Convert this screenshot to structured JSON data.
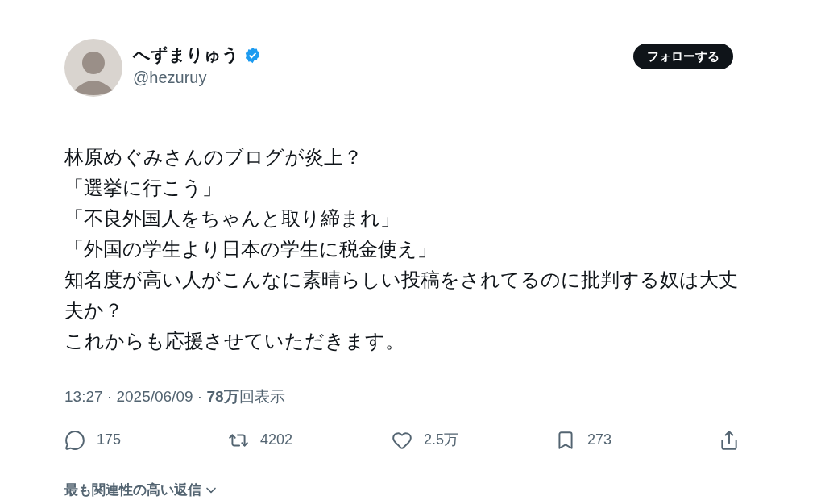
{
  "author": {
    "name": "へずまりゅう",
    "verified": true,
    "handle": "@hezuruy"
  },
  "follow_button": "フォローする",
  "body": [
    "林原めぐみさんのブログが炎上？",
    "「選挙に行こう」",
    "「不良外国人をちゃんと取り締まれ」",
    "「外国の学生より日本の学生に税金使え」",
    "知名度が高い人がこんなに素晴らしい投稿をされてるのに批判する奴は大丈夫か？",
    "これからも応援させていただきます。"
  ],
  "meta": "13:27 · 2025/06/09 · **78万**回表示",
  "actions": [
    {
      "kind": "reply",
      "count": "175"
    },
    {
      "kind": "repost",
      "count": "4202"
    },
    {
      "kind": "like",
      "count": "2.5万"
    },
    {
      "kind": "bookmark",
      "count": "273"
    },
    {
      "kind": "share"
    }
  ],
  "replies_sort": "最も関連性の高い返信"
}
